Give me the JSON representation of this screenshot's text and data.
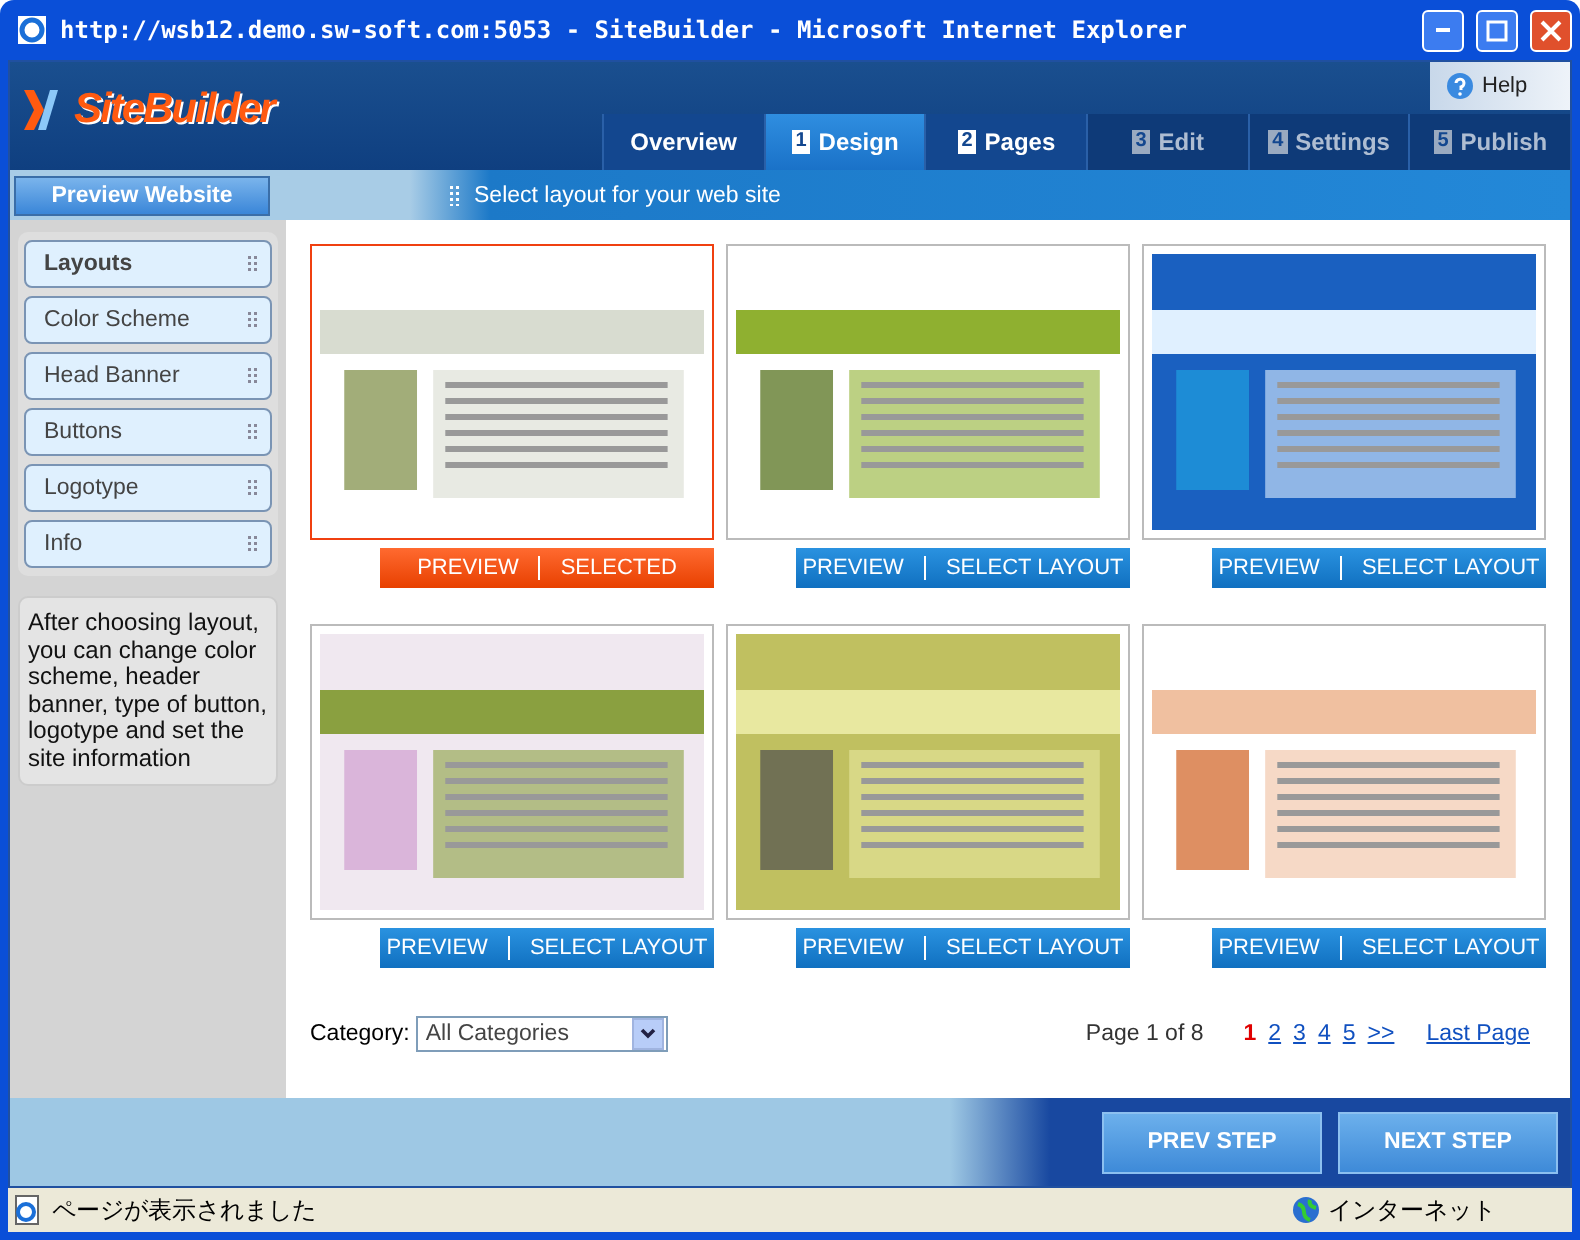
{
  "window": {
    "title": "http://wsb12.demo.sw-soft.com:5053 - SiteBuilder - Microsoft Internet Explorer"
  },
  "header": {
    "logo": "SiteBuilder",
    "help": "Help"
  },
  "tabs": [
    {
      "label": "Overview",
      "selected": false,
      "disabled": false
    },
    {
      "number": "1",
      "label": "Design",
      "selected": true,
      "disabled": false
    },
    {
      "number": "2",
      "label": "Pages",
      "selected": false,
      "disabled": false
    },
    {
      "number": "3",
      "label": "Edit",
      "selected": false,
      "disabled": true
    },
    {
      "number": "4",
      "label": "Settings",
      "selected": false,
      "disabled": true
    },
    {
      "number": "5",
      "label": "Publish",
      "selected": false,
      "disabled": true
    }
  ],
  "preview_button": "Preview Website",
  "hint": "Select layout for your web site",
  "sidebar": {
    "items": [
      {
        "label": "Layouts",
        "selected": true
      },
      {
        "label": "Color Scheme",
        "selected": false
      },
      {
        "label": "Head Banner",
        "selected": false
      },
      {
        "label": "Buttons",
        "selected": false
      },
      {
        "label": "Logotype",
        "selected": false
      },
      {
        "label": "Info",
        "selected": false
      }
    ],
    "note": "After choosing layout, you can change color scheme, header banner, type of button, logotype and set the site information"
  },
  "layouts": [
    {
      "preview": "PREVIEW",
      "action": "SELECTED",
      "selected": true
    },
    {
      "preview": "PREVIEW",
      "action": "SELECT LAYOUT",
      "selected": false
    },
    {
      "preview": "PREVIEW",
      "action": "SELECT LAYOUT",
      "selected": false
    },
    {
      "preview": "PREVIEW",
      "action": "SELECT LAYOUT",
      "selected": false
    },
    {
      "preview": "PREVIEW",
      "action": "SELECT LAYOUT",
      "selected": false
    },
    {
      "preview": "PREVIEW",
      "action": "SELECT LAYOUT",
      "selected": false
    }
  ],
  "category": {
    "label": "Category:",
    "value": "All Categories"
  },
  "pagination": {
    "summary": "Page 1 of 8",
    "pages": [
      {
        "label": "1",
        "selected": true
      },
      {
        "label": "2",
        "selected": false
      },
      {
        "label": "3",
        "selected": false
      },
      {
        "label": "4",
        "selected": false
      },
      {
        "label": "5",
        "selected": false
      }
    ],
    "next": ">>",
    "last": "Last Page"
  },
  "footer": {
    "prev": "PREV STEP",
    "next": "NEXT STEP"
  },
  "status_bar": {
    "message": "ページが表示されました",
    "zone": "インターネット"
  }
}
